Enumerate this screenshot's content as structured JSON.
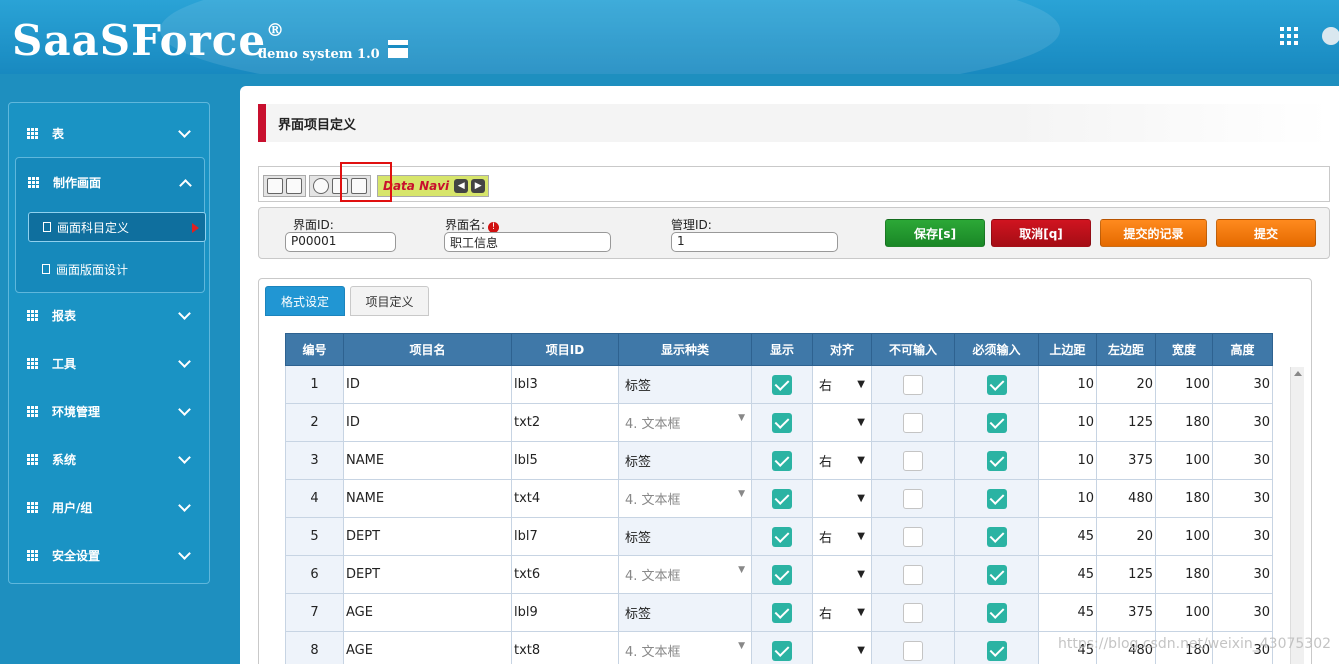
{
  "header": {
    "logo": "SaaSForce",
    "logo_mark": "®",
    "subtitle": "demo system 1.0"
  },
  "sidebar": {
    "items": [
      {
        "label": "表"
      },
      {
        "label": "制作画面"
      },
      {
        "label": "报表"
      },
      {
        "label": "工具"
      },
      {
        "label": "环境管理"
      },
      {
        "label": "系统"
      },
      {
        "label": "用户/组"
      },
      {
        "label": "安全设置"
      }
    ],
    "sub_items": [
      {
        "label": "画面科目定义"
      },
      {
        "label": "画面版面设计"
      }
    ]
  },
  "page": {
    "title": "界面项目定义"
  },
  "toolbar": {
    "navi_label": "Data Navi"
  },
  "form": {
    "screen_id_label": "界面ID:",
    "screen_id_value": "P00001",
    "screen_name_label": "界面名:",
    "screen_name_required": "!",
    "screen_name_value": "职工信息",
    "manage_id_label": "管理ID:",
    "manage_id_value": "1",
    "save_label": "保存[s]",
    "cancel_label": "取消[q]",
    "records_label": "提交的记录",
    "submit_label": "提交"
  },
  "tabs": [
    {
      "label": "格式设定"
    },
    {
      "label": "项目定义"
    }
  ],
  "grid": {
    "columns": [
      "编号",
      "项目名",
      "项目ID",
      "显示种类",
      "显示",
      "对齐",
      "不可输入",
      "必须输入",
      "上边距",
      "左边距",
      "宽度",
      "高度"
    ],
    "rows": [
      {
        "no": "1",
        "name": "ID",
        "id": "lbl3",
        "type": "标签",
        "align": "右",
        "top": "10",
        "left": "20",
        "width": "100",
        "height": "30"
      },
      {
        "no": "2",
        "name": "ID",
        "id": "txt2",
        "type": "4. 文本框",
        "align": "",
        "top": "10",
        "left": "125",
        "width": "180",
        "height": "30"
      },
      {
        "no": "3",
        "name": "NAME",
        "id": "lbl5",
        "type": "标签",
        "align": "右",
        "top": "10",
        "left": "375",
        "width": "100",
        "height": "30"
      },
      {
        "no": "4",
        "name": "NAME",
        "id": "txt4",
        "type": "4. 文本框",
        "align": "",
        "top": "10",
        "left": "480",
        "width": "180",
        "height": "30"
      },
      {
        "no": "5",
        "name": "DEPT",
        "id": "lbl7",
        "type": "标签",
        "align": "右",
        "top": "45",
        "left": "20",
        "width": "100",
        "height": "30"
      },
      {
        "no": "6",
        "name": "DEPT",
        "id": "txt6",
        "type": "4. 文本框",
        "align": "",
        "top": "45",
        "left": "125",
        "width": "180",
        "height": "30"
      },
      {
        "no": "7",
        "name": "AGE",
        "id": "lbl9",
        "type": "标签",
        "align": "右",
        "top": "45",
        "left": "375",
        "width": "100",
        "height": "30"
      },
      {
        "no": "8",
        "name": "AGE",
        "id": "txt8",
        "type": "4. 文本框",
        "align": "",
        "top": "45",
        "left": "480",
        "width": "180",
        "height": "30"
      }
    ]
  },
  "watermark": "https://blog.csdn.net/weixin_43075302"
}
